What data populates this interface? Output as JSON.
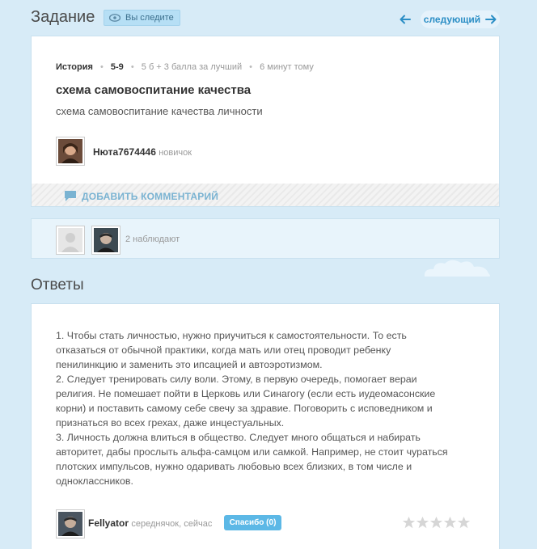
{
  "header": {
    "title": "Задание",
    "watch_label": "Вы следите",
    "next_label": "следующий"
  },
  "question": {
    "subject": "История",
    "grade": "5-9",
    "points": "5 б + 3 балла за лучший",
    "time": "6 минут тому",
    "title": "схема самовоспитание качества",
    "text": "схема самовоспитание качества личности",
    "author": {
      "name": "Нюта7674446",
      "rank": "новичок"
    },
    "add_comment": "ДОБАВИТЬ КОММЕНТАРИЙ"
  },
  "watchers": {
    "count_text": "2 наблюдают"
  },
  "answers": {
    "title": "Ответы",
    "items": [
      {
        "lines": [
          "1. Чтобы стать личностью, нужно приучиться к самостоятельности. То есть",
          "отказаться от обычной практики, когда мать или отец проводит ребенку",
          "пенилинкцию и заменить это ипсацией и автоэротизмом.",
          "2. Следует тренировать силу воли. Этому, в первую очередь, помогает вераи",
          "религия. Не помешает пойти в Церковь или Синагогу (если есть иудеомасонские",
          "корни) и поставить самому себе свечу за здравие. Поговорить с исповедником и",
          "признаться во всех грехах, даже инцестуальных.",
          "3. Личность должна влиться в общество. Следует много общаться и набирать",
          "авторитет, дабы прослыть альфа-самцом или самкой. Например, не стоит чураться",
          "плотских импульсов, нужно одаривать любовью всех близких, в том числе и",
          "одноклассников."
        ],
        "author": {
          "name": "Fellyator",
          "rank": "середнячок",
          "time": "сейчас"
        },
        "thanks_label": "Спасибо (0)",
        "rating": 0,
        "rating_max": 5
      }
    ]
  },
  "colors": {
    "background": "#d7ebf7",
    "accent": "#2b8ec5",
    "thanks": "#5cb8e6"
  }
}
